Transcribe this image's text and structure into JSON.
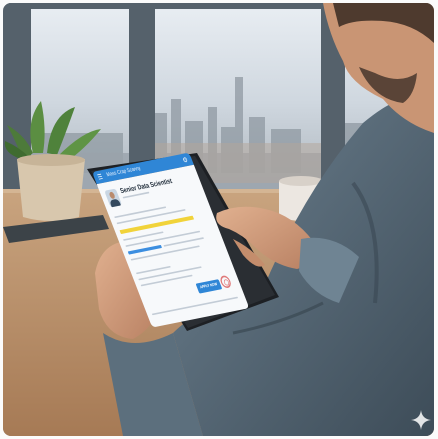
{
  "tablet_screen": {
    "header_title": "Mass Crap Scanny",
    "job_title": "Senior Data Scientist",
    "menu_icon": "hamburger-icon",
    "settings_icon": "gear-icon",
    "apply_button_label": "APPLY NOW"
  },
  "colors": {
    "tablet_header": "#2f86d6",
    "highlight_yellow": "#f1d33a",
    "highlight_blue": "#3c8ee0",
    "seal_red": "#e07a7a"
  }
}
